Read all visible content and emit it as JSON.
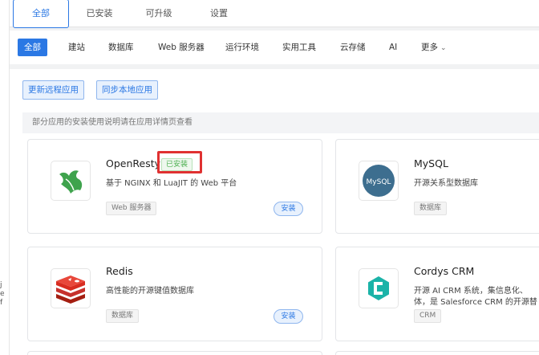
{
  "top_tabs": [
    {
      "label": "全部",
      "active": true
    },
    {
      "label": "已安装",
      "active": false
    },
    {
      "label": "可升级",
      "active": false
    },
    {
      "label": "设置",
      "active": false
    }
  ],
  "categories": [
    {
      "label": "全部",
      "active": true
    },
    {
      "label": "建站"
    },
    {
      "label": "数据库"
    },
    {
      "label": "Web 服务器"
    },
    {
      "label": "运行环境"
    },
    {
      "label": "实用工具"
    },
    {
      "label": "云存储"
    },
    {
      "label": "AI"
    },
    {
      "label": "更多"
    }
  ],
  "actions": {
    "update_remote": "更新远程应用",
    "sync_local": "同步本地应用"
  },
  "notice": "部分应用的安装使用说明请在应用详情页查看",
  "apps": [
    {
      "name": "OpenResty",
      "desc": "基于 NGINX 和 LuaJIT 的 Web 平台",
      "tag": "Web 服务器",
      "installed_label": "已安装",
      "install_label": "安装",
      "icon": "openresty-icon"
    },
    {
      "name": "MySQL",
      "desc": "开源关系型数据库",
      "tag": "数据库",
      "icon": "mysql-icon"
    },
    {
      "name": "Redis",
      "desc": "高性能的开源键值数据库",
      "tag": "数据库",
      "install_label": "安装",
      "icon": "redis-icon"
    },
    {
      "name": "Cordys CRM",
      "desc": "开源 AI CRM 系统，集信息化、",
      "desc2": "体，是 Salesforce CRM 的开源替",
      "tag": "CRM",
      "icon": "cordys-icon"
    }
  ],
  "left_edge_glyphs": [
    "j",
    "e",
    "f"
  ],
  "colors": {
    "accent": "#2b78e4",
    "installed": "#4caf50",
    "highlight": "#e03131"
  }
}
